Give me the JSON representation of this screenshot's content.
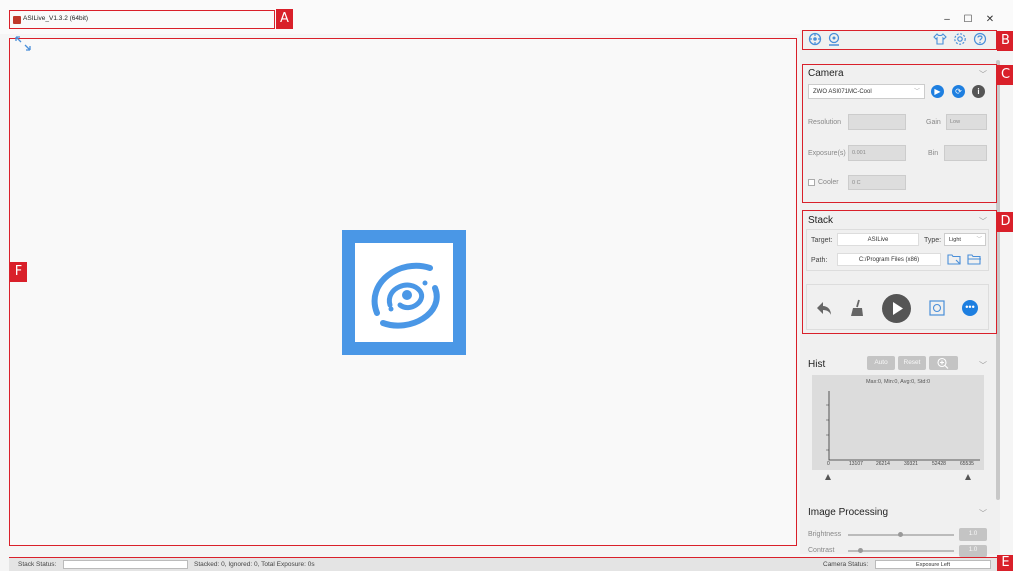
{
  "window": {
    "title": "ASILive_V1.3.2 (64bit)",
    "minimize": "–",
    "maximize": "☐",
    "close": "✕"
  },
  "tags": {
    "a": "A",
    "b": "B",
    "c": "C",
    "d": "D",
    "e": "E",
    "f": "F"
  },
  "toolbar": {
    "left_icons": [
      "focus-icon",
      "camera-connect-icon"
    ],
    "right_icons": [
      "shirt-icon",
      "settings-icon",
      "help-icon"
    ]
  },
  "camera": {
    "title": "Camera",
    "model": "ZWO ASI071MC-Cool",
    "resolution_label": "Resolution",
    "gain_label": "Gain",
    "gain_value": "Low",
    "exposure_label": "Exposure(s)",
    "exposure_value": "0.001",
    "bin_label": "Bin",
    "cooler_label": "Cooler",
    "cooler_value": "0 C"
  },
  "stack": {
    "title": "Stack",
    "target_label": "Target:",
    "target_value": "ASILive",
    "type_label": "Type:",
    "type_value": "Light",
    "path_label": "Path:",
    "path_value": "C:/Program Files (x86)"
  },
  "hist": {
    "title": "Hist",
    "auto": "Auto",
    "reset": "Reset",
    "stats": "Max:0, Min:0, Avg:0, Std:0",
    "ticks": [
      "0",
      "13107",
      "26214",
      "39321",
      "52428",
      "65535"
    ]
  },
  "image_processing": {
    "title": "Image Processing",
    "brightness_label": "Brightness",
    "brightness_value": "1.0",
    "contrast_label": "Contrast",
    "contrast_value": "1.0"
  },
  "status": {
    "stack_status_label": "Stack Status:",
    "stacked_text": "Stacked: 0, Ignored: 0, Total Exposure: 0s",
    "camera_status_label": "Camera Status:",
    "camera_status_value": "Exposure Left"
  },
  "colors": {
    "accent": "#4a97e6",
    "annotation": "#d9202a"
  }
}
